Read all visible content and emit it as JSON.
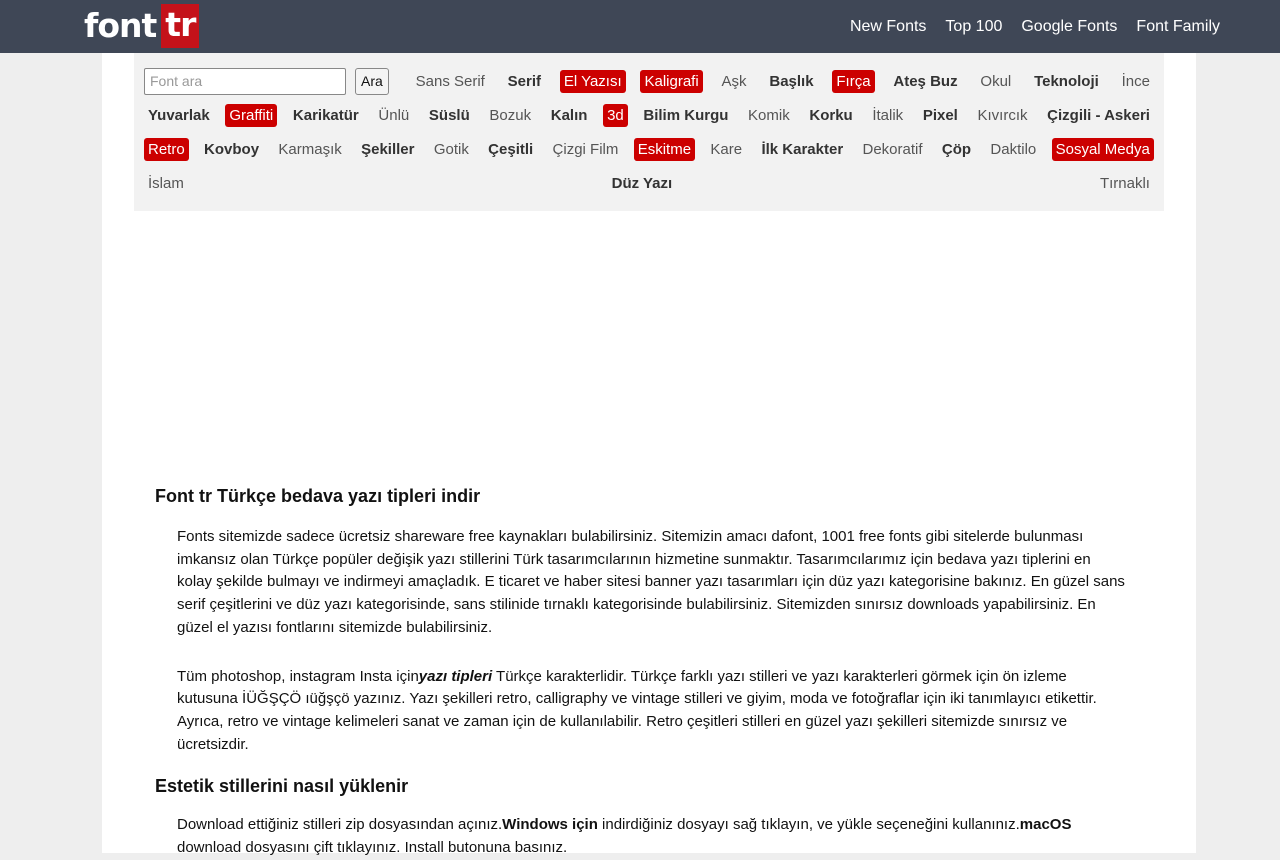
{
  "header": {
    "logo_font": "font",
    "logo_tr": "tr",
    "nav": [
      "New Fonts",
      "Top 100",
      "Google Fonts",
      "Font Family"
    ]
  },
  "search": {
    "placeholder": "Font ara",
    "button_label": "Ara"
  },
  "categories": {
    "row1": [
      {
        "label": "Sans Serif",
        "style": "normal"
      },
      {
        "label": "Serif",
        "style": "bold"
      },
      {
        "label": "El Yazısı",
        "style": "red"
      },
      {
        "label": "Kaligrafi",
        "style": "red"
      },
      {
        "label": "Aşk",
        "style": "normal"
      },
      {
        "label": "Başlık",
        "style": "bold"
      },
      {
        "label": "Fırça",
        "style": "red"
      },
      {
        "label": "Ateş Buz",
        "style": "bold"
      },
      {
        "label": "Okul",
        "style": "normal"
      },
      {
        "label": "Teknoloji",
        "style": "bold"
      },
      {
        "label": "İnce",
        "style": "normal"
      }
    ],
    "row2": [
      {
        "label": "Yuvarlak",
        "style": "bold"
      },
      {
        "label": "Graffiti",
        "style": "red"
      },
      {
        "label": "Karikatür",
        "style": "bold"
      },
      {
        "label": "Ünlü",
        "style": "normal"
      },
      {
        "label": "Süslü",
        "style": "bold"
      },
      {
        "label": "Bozuk",
        "style": "normal"
      },
      {
        "label": "Kalın",
        "style": "bold"
      },
      {
        "label": "3d",
        "style": "red"
      },
      {
        "label": "Bilim Kurgu",
        "style": "bold"
      },
      {
        "label": "Komik",
        "style": "normal"
      },
      {
        "label": "Korku",
        "style": "bold"
      },
      {
        "label": "İtalik",
        "style": "normal"
      },
      {
        "label": "Pixel",
        "style": "bold"
      },
      {
        "label": "Kıvırcık",
        "style": "normal"
      },
      {
        "label": "Çizgili - Askeri",
        "style": "bold"
      }
    ],
    "row3": [
      {
        "label": "Retro",
        "style": "red"
      },
      {
        "label": "Kovboy",
        "style": "bold"
      },
      {
        "label": "Karmaşık",
        "style": "normal"
      },
      {
        "label": "Şekiller",
        "style": "bold"
      },
      {
        "label": "Gotik",
        "style": "normal"
      },
      {
        "label": "Çeşitli",
        "style": "bold"
      },
      {
        "label": "Çizgi Film",
        "style": "normal"
      },
      {
        "label": "Eskitme",
        "style": "red"
      },
      {
        "label": "Kare",
        "style": "normal"
      },
      {
        "label": "İlk Karakter",
        "style": "bold"
      },
      {
        "label": "Dekoratif",
        "style": "normal"
      },
      {
        "label": "Çöp",
        "style": "bold"
      },
      {
        "label": "Daktilo",
        "style": "normal"
      },
      {
        "label": "Sosyal Medya",
        "style": "red"
      }
    ],
    "row4": [
      {
        "label": "İslam",
        "style": "normal"
      },
      {
        "label": "Düz Yazı",
        "style": "bold"
      },
      {
        "label": "Tırnaklı",
        "style": "normal"
      }
    ]
  },
  "article": {
    "heading1": "Font tr Türkçe bedava yazı tipleri indir",
    "p1": "Fonts sitemizde sadece ücretsiz shareware free kaynakları bulabilirsiniz. Sitemizin amacı dafont, 1001 free fonts gibi sitelerde bulunması imkansız olan Türkçe popüler değişik yazı stillerini Türk tasarımcılarının hizmetine sunmaktır. Tasarımcılarımız için bedava yazı tiplerini en kolay şekilde bulmayı ve indirmeyi amaçladık. E ticaret ve haber sitesi banner yazı tasarımları için düz yazı kategorisine bakınız. En güzel sans serif çeşitlerini ve düz yazı kategorisinde, sans stilinide tırnaklı kategorisinde bulabilirsiniz. Sitemizden sınırsız downloads yapabilirsiniz. En güzel el yazısı fontlarını sitemizde bulabilirsiniz.",
    "p2_before": "Tüm photoshop, instagram Insta için",
    "p2_em": "yazı tipleri",
    "p2_after": " Türkçe karakterlidir. Türkçe farklı yazı stilleri ve yazı karakterleri görmek için ön izleme kutusuna İÜĞŞÇÖ ıüğşçö yazınız. Yazı şekilleri retro, calligraphy ve vintage stilleri ve giyim, moda ve fotoğraflar için iki tanımlayıcı etikettir. Ayrıca, retro ve vintage kelimeleri sanat ve zaman için de kullanılabilir. Retro çeşitleri stilleri en güzel yazı şekilleri sitemizde sınırsız ve ücretsizdir.",
    "heading2": "Estetik stillerini nasıl yüklenir",
    "p3_1": "Download ettiğiniz stilleri zip dosyasından açınız.",
    "p3_b1": "Windows için",
    "p3_2": " indirdiğiniz dosyayı sağ tıklayın, ve yükle seçeneğini kullanınız.",
    "p3_b2": "macOS",
    "p3_3": " download dosyasını çift tıklayınız. Install butonuna basınız."
  }
}
